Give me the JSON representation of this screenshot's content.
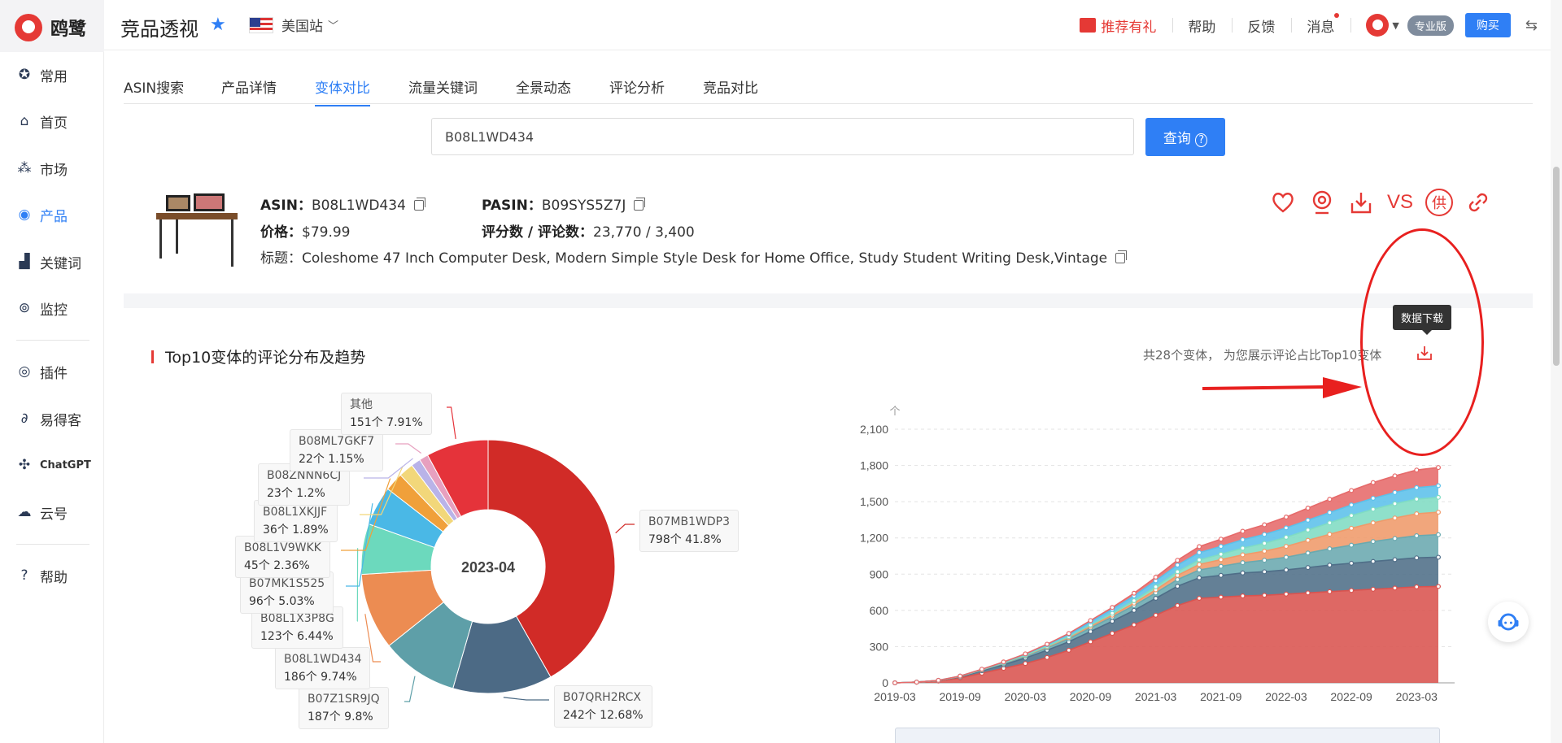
{
  "brand": {
    "name": "鸥鹭"
  },
  "sidebar": {
    "items": [
      {
        "label": "常用",
        "icon": "star-circle-icon"
      },
      {
        "label": "首页",
        "icon": "home-icon"
      },
      {
        "label": "市场",
        "icon": "grid-icon"
      },
      {
        "label": "产品",
        "icon": "eye-icon"
      },
      {
        "label": "关键词",
        "icon": "bar-chart-icon"
      },
      {
        "label": "监控",
        "icon": "monitor-icon"
      },
      {
        "label": "插件",
        "icon": "chrome-icon"
      },
      {
        "label": "易得客",
        "icon": "link-icon"
      },
      {
        "label": "ChatGPT",
        "icon": "openai-icon"
      },
      {
        "label": "云号",
        "icon": "cloud-icon"
      },
      {
        "label": "帮助",
        "icon": "question-icon"
      }
    ]
  },
  "header": {
    "title": "竞品透视",
    "site": "美国站",
    "recommend": "推荐有礼",
    "help": "帮助",
    "feedback": "反馈",
    "messages": "消息",
    "plan": "专业版",
    "buy": "购买"
  },
  "tabs": [
    "ASIN搜索",
    "产品详情",
    "变体对比",
    "流量关键词",
    "全景动态",
    "评论分析",
    "竞品对比"
  ],
  "search": {
    "value": "B08L1WD434",
    "button": "查询"
  },
  "product": {
    "asin_label": "ASIN：",
    "asin": "B08L1WD434",
    "pasin_label": "PASIN：",
    "pasin": "B09SYS5Z7J",
    "price_label": "价格：",
    "price": "$79.99",
    "rating_label": "评分数 / 评论数：",
    "rating": "23,770 / 3,400",
    "title_label": "标题：",
    "title": "Coleshome 47 Inch Computer Desk, Modern Simple Style Desk for Home Office, Study Student Writing Desk,Vintage",
    "actions": [
      "heart-icon",
      "webcam-icon",
      "download-icon",
      "vs-icon",
      "supply-icon",
      "link-icon"
    ],
    "vs_text": "VS",
    "supply_text": "供"
  },
  "section": {
    "title": "Top10变体的评论分布及趋势",
    "note": "共28个变体， 为您展示评论占比Top10变体",
    "tooltip": "数据下载"
  },
  "chart_data": [
    {
      "type": "pie",
      "center_label": "2023-04",
      "slices": [
        {
          "name": "B07MB1WDP3",
          "count": "798个",
          "percent": "41.8%",
          "value": 798,
          "color": "#d12b27"
        },
        {
          "name": "B07QRH2RCX",
          "count": "242个",
          "percent": "12.68%",
          "value": 242,
          "color": "#4c6a85"
        },
        {
          "name": "B07Z1SR9JQ",
          "count": "187个",
          "percent": "9.8%",
          "value": 187,
          "color": "#5e9fa8"
        },
        {
          "name": "B08L1WD434",
          "count": "186个",
          "percent": "9.74%",
          "value": 186,
          "color": "#ec8c52"
        },
        {
          "name": "B08L1X3P8G",
          "count": "123个",
          "percent": "6.44%",
          "value": 123,
          "color": "#6cd9bd"
        },
        {
          "name": "B07MK1S525",
          "count": "96个",
          "percent": "5.03%",
          "value": 96,
          "color": "#4ab8e6"
        },
        {
          "name": "B08L1V9WKK",
          "count": "45个",
          "percent": "2.36%",
          "value": 45,
          "color": "#f0a03a"
        },
        {
          "name": "B08L1XKJJF",
          "count": "36个",
          "percent": "1.89%",
          "value": 36,
          "color": "#f2d77a"
        },
        {
          "name": "B08ZNNN6CJ",
          "count": "23个",
          "percent": "1.2%",
          "value": 23,
          "color": "#b9b3e8"
        },
        {
          "name": "B08ML7GKF7",
          "count": "22个",
          "percent": "1.15%",
          "value": 22,
          "color": "#e7a0bf"
        },
        {
          "name": "其他",
          "count": "151个",
          "percent": "7.91%",
          "value": 151,
          "color": "#e5333a"
        }
      ]
    },
    {
      "type": "area",
      "stacked": true,
      "x_ticks": [
        "2019-03",
        "2019-09",
        "2020-03",
        "2020-09",
        "2021-03",
        "2021-09",
        "2022-03",
        "2022-09",
        "2023-03"
      ],
      "y_ticks": [
        "0",
        "300",
        "600",
        "900",
        "1,200",
        "1,500",
        "1,800",
        "2,100"
      ],
      "y_unit": "个",
      "ylim": [
        0,
        2100
      ],
      "x": [
        "2019-03",
        "2019-05",
        "2019-07",
        "2019-09",
        "2019-11",
        "2020-01",
        "2020-03",
        "2020-05",
        "2020-07",
        "2020-09",
        "2020-11",
        "2021-01",
        "2021-03",
        "2021-05",
        "2021-07",
        "2021-09",
        "2021-11",
        "2022-01",
        "2022-03",
        "2022-05",
        "2022-07",
        "2022-09",
        "2022-11",
        "2023-01",
        "2023-03",
        "2023-04"
      ],
      "series": [
        {
          "name": "B07MB1WDP3",
          "color": "#d9534f",
          "values": [
            0,
            5,
            15,
            40,
            80,
            120,
            160,
            210,
            270,
            340,
            410,
            480,
            560,
            640,
            700,
            710,
            720,
            725,
            735,
            745,
            755,
            765,
            775,
            785,
            795,
            798
          ]
        },
        {
          "name": "B07QRH2RCX",
          "color": "#4f6e88",
          "values": [
            0,
            1,
            4,
            10,
            20,
            30,
            45,
            60,
            70,
            85,
            100,
            120,
            140,
            160,
            170,
            180,
            190,
            195,
            200,
            210,
            220,
            225,
            230,
            235,
            240,
            242
          ]
        },
        {
          "name": "B07Z1SR9JQ",
          "color": "#6aa9af",
          "values": [
            0,
            0,
            1,
            3,
            6,
            10,
            15,
            20,
            25,
            30,
            35,
            40,
            45,
            55,
            65,
            75,
            85,
            95,
            105,
            120,
            135,
            150,
            165,
            175,
            183,
            187
          ]
        },
        {
          "name": "B08L1WD434",
          "color": "#ef9a6a",
          "values": [
            0,
            0,
            0,
            1,
            2,
            4,
            6,
            8,
            10,
            12,
            15,
            20,
            25,
            35,
            45,
            55,
            65,
            75,
            90,
            105,
            120,
            140,
            155,
            170,
            182,
            186
          ]
        },
        {
          "name": "B08L1X3P8G",
          "color": "#7fdcc3",
          "values": [
            0,
            0,
            0,
            0,
            1,
            2,
            3,
            5,
            8,
            12,
            16,
            20,
            25,
            30,
            38,
            45,
            55,
            65,
            75,
            85,
            95,
            105,
            112,
            118,
            121,
            123
          ]
        },
        {
          "name": "B07MK1S525",
          "color": "#5cc0ea",
          "values": [
            0,
            0,
            1,
            2,
            3,
            5,
            8,
            12,
            18,
            25,
            32,
            40,
            50,
            55,
            60,
            65,
            70,
            74,
            78,
            82,
            85,
            88,
            91,
            93,
            95,
            96
          ]
        },
        {
          "name": "其他",
          "color": "#e66a6a",
          "values": [
            0,
            0,
            0,
            0,
            1,
            2,
            3,
            5,
            8,
            12,
            16,
            22,
            30,
            40,
            50,
            60,
            70,
            80,
            90,
            100,
            110,
            120,
            130,
            138,
            146,
            151
          ]
        }
      ]
    }
  ],
  "annotations": {
    "oval": "red-oval-annotation",
    "arrow": "red-arrow-annotation"
  }
}
